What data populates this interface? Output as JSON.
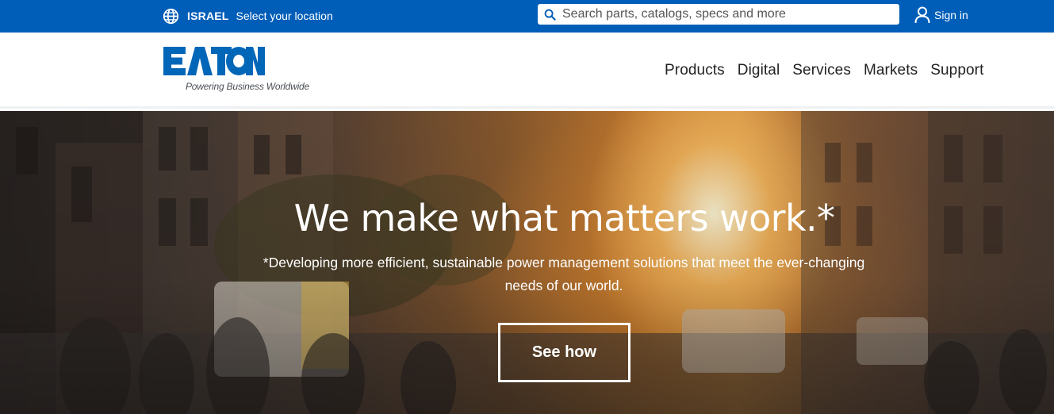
{
  "topbar": {
    "country": "ISRAEL",
    "location_link": "Select your location",
    "search_placeholder": "Search parts, catalogs, specs and more",
    "sign_in": "Sign in",
    "bg_color": "#005eb8"
  },
  "header": {
    "logo_text": "EATON",
    "tagline": "Powering Business Worldwide",
    "brand_color": "#0067b8",
    "nav": [
      {
        "label": "Products"
      },
      {
        "label": "Digital"
      },
      {
        "label": "Services"
      },
      {
        "label": "Markets"
      },
      {
        "label": "Support"
      }
    ]
  },
  "hero": {
    "headline": "We make what matters work.*",
    "subtext": "*Developing more efficient, sustainable power management solutions that meet the ever-changing needs of our world.",
    "cta": "See how"
  },
  "icons": {
    "globe": "globe-icon",
    "search": "search-icon",
    "user": "user-icon"
  }
}
